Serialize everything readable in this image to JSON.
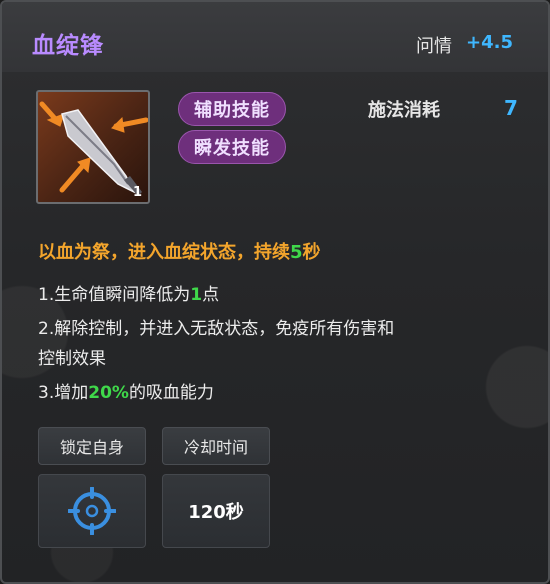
{
  "skill": {
    "name": "血绽锋",
    "stat_label": "问情",
    "stat_value": "+4.5",
    "icon": "blood-dagger-icon",
    "icon_level": "1",
    "tags": [
      "辅助技能",
      "瞬发技能"
    ],
    "cost_label": "施法消耗",
    "cost_value": "7"
  },
  "description": {
    "main_prefix": "以血为祭，进入血绽状态，持续",
    "main_highlight": "5",
    "main_suffix": "秒",
    "line1_prefix": "1.生命值瞬间降低为",
    "line1_highlight": "1",
    "line1_suffix": "点",
    "line2a": "2.解除控制，并进入无敌状态，免疫所有伤害和",
    "line2b": "控制效果",
    "line3_prefix": "3.增加",
    "line3_highlight": "20%",
    "line3_suffix": "的吸血能力"
  },
  "controls": {
    "lock_label": "锁定自身",
    "cooldown_label": "冷却时间",
    "target_icon": "crosshair-icon",
    "cooldown_value": "120秒"
  },
  "colors": {
    "title": "#b98bff",
    "accent_blue": "#3fb7ff",
    "main_desc": "#f3a52c",
    "highlight_green": "#3fd84a",
    "tag_bg": "#6e2f7c"
  }
}
